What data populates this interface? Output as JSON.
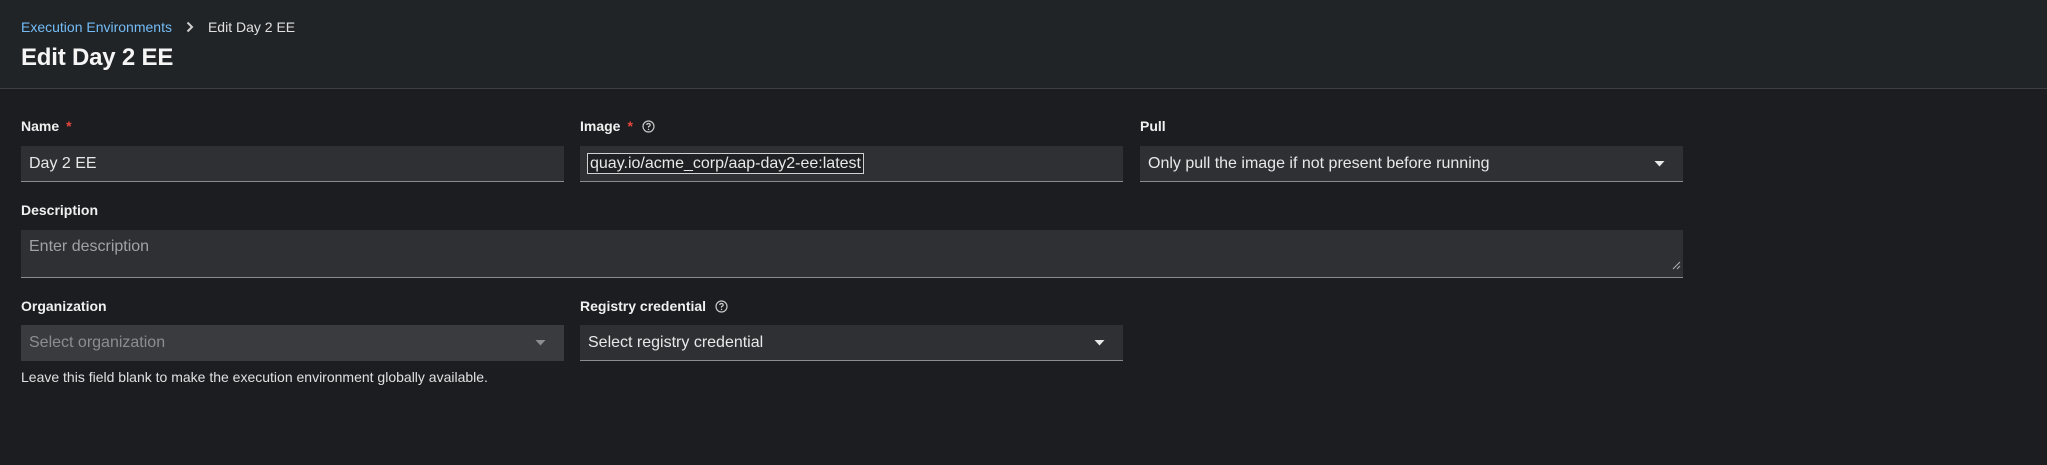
{
  "breadcrumb": {
    "parent": "Execution Environments",
    "current": "Edit Day 2 EE"
  },
  "page_title": "Edit Day 2 EE",
  "form": {
    "name": {
      "label": "Name",
      "required": "*",
      "value": "Day 2 EE"
    },
    "image": {
      "label": "Image",
      "required": "*",
      "value": "quay.io/acme_corp/aap-day2-ee:latest"
    },
    "pull": {
      "label": "Pull",
      "value": "Only pull the image if not present before running"
    },
    "description": {
      "label": "Description",
      "placeholder": "Enter description"
    },
    "organization": {
      "label": "Organization",
      "placeholder": "Select organization",
      "helper": "Leave this field blank to make the execution environment globally available."
    },
    "registry_credential": {
      "label": "Registry credential",
      "placeholder": "Select registry credential"
    }
  },
  "icons": {
    "breadcrumb_separator": "chevron-right-icon",
    "help": "question-circle-icon",
    "dropdown": "caret-down-icon",
    "resize": "resize-handle-icon"
  },
  "colors": {
    "link": "#73bcf7",
    "required": "#e8453c",
    "background": "#1b1d21",
    "header": "#212427",
    "field": "#2e3034"
  }
}
